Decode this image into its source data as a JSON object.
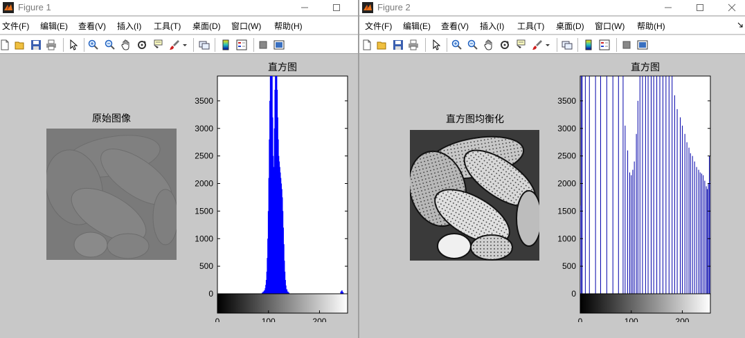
{
  "colors": {
    "hist_blue": "#0000ff",
    "stem_blue": "#0000aa",
    "figure_bg": "#c8c8c8"
  },
  "windows": [
    {
      "title": "Figure 1",
      "menu": [
        "文件(F)",
        "编辑(E)",
        "查看(V)",
        "插入(I)",
        "工具(T)",
        "桌面(D)",
        "窗口(W)",
        "帮助(H)"
      ],
      "image_title": "原始图像",
      "hist_title": "直方图"
    },
    {
      "title": "Figure 2",
      "menu": [
        "文件(F)",
        "编辑(E)",
        "查看(V)",
        "插入(I)",
        "工具(T)",
        "桌面(D)",
        "窗口(W)",
        "帮助(H)"
      ],
      "image_title": "直方图均衡化",
      "hist_title": "直方图"
    }
  ],
  "toolbar_icons": [
    "new-file-icon",
    "open-folder-icon",
    "save-icon",
    "print-icon",
    "pointer-icon",
    "zoom-in-icon",
    "zoom-out-icon",
    "pan-hand-icon",
    "rotate-3d-icon",
    "data-cursor-icon",
    "brush-icon",
    "dropdown-arrow-icon",
    "link-plot-icon",
    "colorbar-icon",
    "legend-icon",
    "hide-plot-tools-icon",
    "show-plot-tools-icon"
  ],
  "chart_data": [
    {
      "type": "bar",
      "title": "直方图",
      "xlim": [
        0,
        255
      ],
      "ylim": [
        0,
        3950
      ],
      "xticks": [
        0,
        100,
        200
      ],
      "yticks": [
        0,
        500,
        1000,
        1500,
        2000,
        2500,
        3000,
        3500
      ],
      "series": [
        {
          "x": [
            88,
            90,
            92,
            94,
            95,
            96,
            97,
            98,
            99,
            100,
            101,
            102,
            103,
            104,
            105,
            106,
            107,
            108,
            109,
            110,
            111,
            112,
            113,
            114,
            115,
            116,
            117,
            118,
            119,
            120,
            121,
            122,
            123,
            124,
            125,
            126,
            127,
            128,
            129,
            130,
            131,
            132,
            133,
            134,
            136,
            138,
            140,
            242,
            244,
            246
          ],
          "values": [
            20,
            40,
            60,
            100,
            160,
            250,
            400,
            650,
            1000,
            1500,
            2100,
            2800,
            3500,
            3950,
            3950,
            3950,
            3950,
            3200,
            2500,
            2050,
            2300,
            3000,
            3700,
            3950,
            3950,
            3950,
            3700,
            3200,
            2800,
            2500,
            2400,
            2300,
            2200,
            2100,
            2000,
            1900,
            1750,
            1500,
            1200,
            900,
            600,
            400,
            250,
            150,
            80,
            40,
            20,
            40,
            60,
            30
          ]
        }
      ]
    },
    {
      "type": "bar",
      "title": "直方图",
      "xlim": [
        0,
        255
      ],
      "ylim": [
        0,
        3950
      ],
      "xticks": [
        0,
        100,
        200
      ],
      "yticks": [
        0,
        500,
        1000,
        1500,
        2000,
        2500,
        3000,
        3500
      ],
      "series": [
        {
          "x": [
            0,
            2,
            4,
            10,
            18,
            30,
            40,
            52,
            64,
            75,
            84,
            88,
            93,
            97,
            100,
            103,
            106,
            110,
            113,
            117,
            122,
            128,
            133,
            139,
            144,
            150,
            156,
            162,
            168,
            174,
            180,
            185,
            190,
            196,
            200,
            205,
            209,
            213,
            216,
            220,
            224,
            228,
            232,
            235,
            238,
            241,
            244,
            247,
            249,
            251,
            253,
            255
          ],
          "values": [
            1600,
            3950,
            3950,
            3950,
            3950,
            3950,
            3950,
            3950,
            3950,
            3950,
            3950,
            3050,
            2600,
            2200,
            2150,
            2250,
            2400,
            2900,
            3500,
            3950,
            3950,
            3950,
            3950,
            3950,
            3950,
            3950,
            3950,
            3950,
            3950,
            3950,
            3950,
            3600,
            3350,
            3200,
            3050,
            2900,
            2750,
            2650,
            2550,
            2500,
            2400,
            2300,
            2250,
            2200,
            2180,
            2150,
            2050,
            1950,
            1900,
            2000,
            2500,
            2050
          ]
        }
      ]
    }
  ]
}
